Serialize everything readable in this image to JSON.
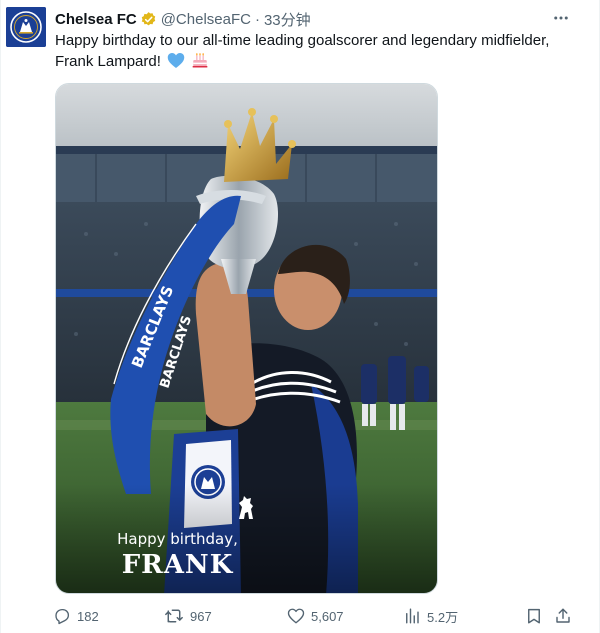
{
  "tweet": {
    "author_name": "Chelsea FC",
    "handle": "@ChelseaFC",
    "separator": "·",
    "time": "33分钟",
    "text_line1": "Happy birthday to our all-time leading goalscorer and legendary midfielder,",
    "text_line2": "Frank Lampard!",
    "emojis": [
      "blue-heart",
      "birthday-cake"
    ]
  },
  "media": {
    "caption_line1": "Happy birthday,",
    "caption_line2": "FRANK",
    "scarf_text": "BARCLAYS"
  },
  "actions": {
    "replies": "182",
    "reposts": "967",
    "likes": "5,607",
    "views": "5.2万"
  },
  "icons": [
    "verified-badge-icon",
    "more-icon",
    "reply-icon",
    "repost-icon",
    "like-icon",
    "views-icon",
    "bookmark-icon",
    "share-icon"
  ],
  "colors": {
    "chelsea_blue": "#1b3f95",
    "verified_gold": "#e2b719",
    "text_primary": "#0f1419",
    "text_secondary": "#536471"
  }
}
